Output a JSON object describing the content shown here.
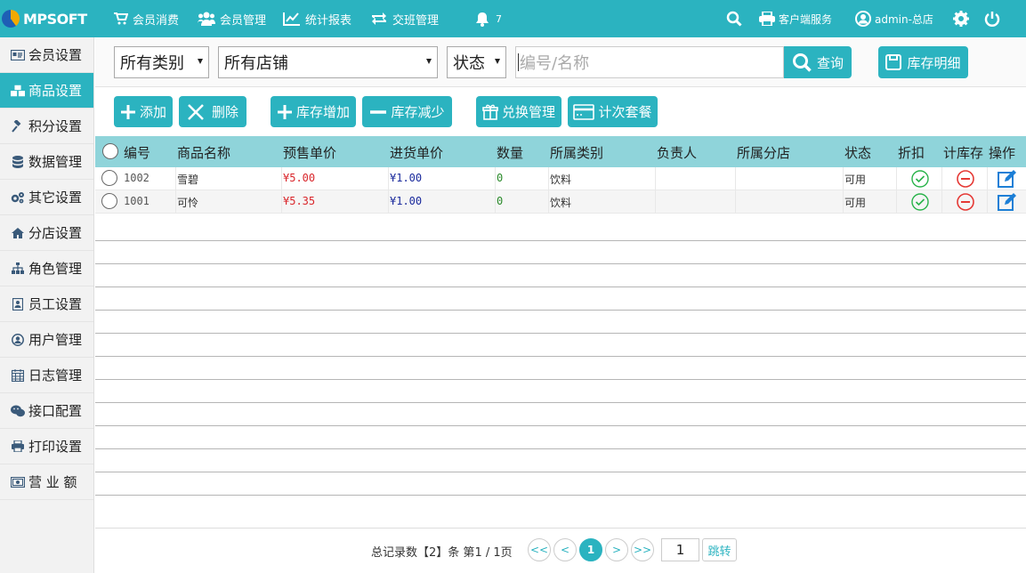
{
  "app": {
    "logo_text": "MPSOFT"
  },
  "topnav": {
    "items": [
      {
        "label": "会员消费",
        "icon": "cart-icon"
      },
      {
        "label": "会员管理",
        "icon": "users-icon"
      },
      {
        "label": "统计报表",
        "icon": "chart-line-icon"
      },
      {
        "label": "交班管理",
        "icon": "retweet-icon"
      }
    ],
    "notifications_count": "7",
    "client_service": "客户端服务",
    "user": "admin-总店"
  },
  "sidebar": {
    "items": [
      {
        "label": "会员设置",
        "icon": "id-card-icon"
      },
      {
        "label": "商品设置",
        "icon": "cubes-icon",
        "active": true
      },
      {
        "label": "积分设置",
        "icon": "gavel-icon"
      },
      {
        "label": "数据管理",
        "icon": "database-icon"
      },
      {
        "label": "其它设置",
        "icon": "cogs-icon"
      },
      {
        "label": "分店设置",
        "icon": "home-icon"
      },
      {
        "label": "角色管理",
        "icon": "sitemap-icon"
      },
      {
        "label": "员工设置",
        "icon": "contact-card-icon"
      },
      {
        "label": "用户管理",
        "icon": "user-circle-icon"
      },
      {
        "label": "日志管理",
        "icon": "calendar-icon"
      },
      {
        "label": "接口配置",
        "icon": "wechat-icon"
      },
      {
        "label": "打印设置",
        "icon": "print-icon"
      },
      {
        "label": "营 业 额",
        "icon": "money-icon"
      }
    ]
  },
  "filters": {
    "category": "所有类别",
    "store": "所有店铺",
    "status": "状态",
    "search_placeholder": "编号/名称",
    "query_label": "查询",
    "stock_detail_label": "库存明细"
  },
  "actions": {
    "add": "添加",
    "delete": "删除",
    "stock_increase": "库存增加",
    "stock_decrease": "库存减少",
    "exchange": "兑换管理",
    "count_package": "计次套餐"
  },
  "table": {
    "headers": [
      "编号",
      "商品名称",
      "预售单价",
      "进货单价",
      "数量",
      "所属类别",
      "负责人",
      "所属分店",
      "状态",
      "折扣",
      "计库存",
      "操作"
    ],
    "rows": [
      {
        "code": "1002",
        "name": "雪碧",
        "sale_price": "¥5.00",
        "cost_price": "¥1.00",
        "qty": "0",
        "category": "饮料",
        "owner": "",
        "store": "",
        "status": "可用"
      },
      {
        "code": "1001",
        "name": "可怜",
        "sale_price": "¥5.35",
        "cost_price": "¥1.00",
        "qty": "0",
        "category": "饮料",
        "owner": "",
        "store": "",
        "status": "可用"
      }
    ]
  },
  "pager": {
    "summary_prefix": "总记录数【",
    "total": "2",
    "summary_mid": "】条 第",
    "page": "1",
    "sep": " / ",
    "pages": "1",
    "summary_suffix": "页",
    "first": "<<",
    "prev": "<",
    "current": "1",
    "next": ">",
    "last": ">>",
    "input_value": "1",
    "jump_label": "跳转"
  },
  "colors": {
    "accent": "#2bb3c0",
    "header_row": "#8fd4da",
    "sale_price": "#d9262b",
    "cost_price": "#1a2a9c",
    "qty": "#2a8a2a",
    "ok_icon": "#29b34a",
    "no_icon": "#e53935",
    "edit_icon": "#1d7fd6"
  }
}
